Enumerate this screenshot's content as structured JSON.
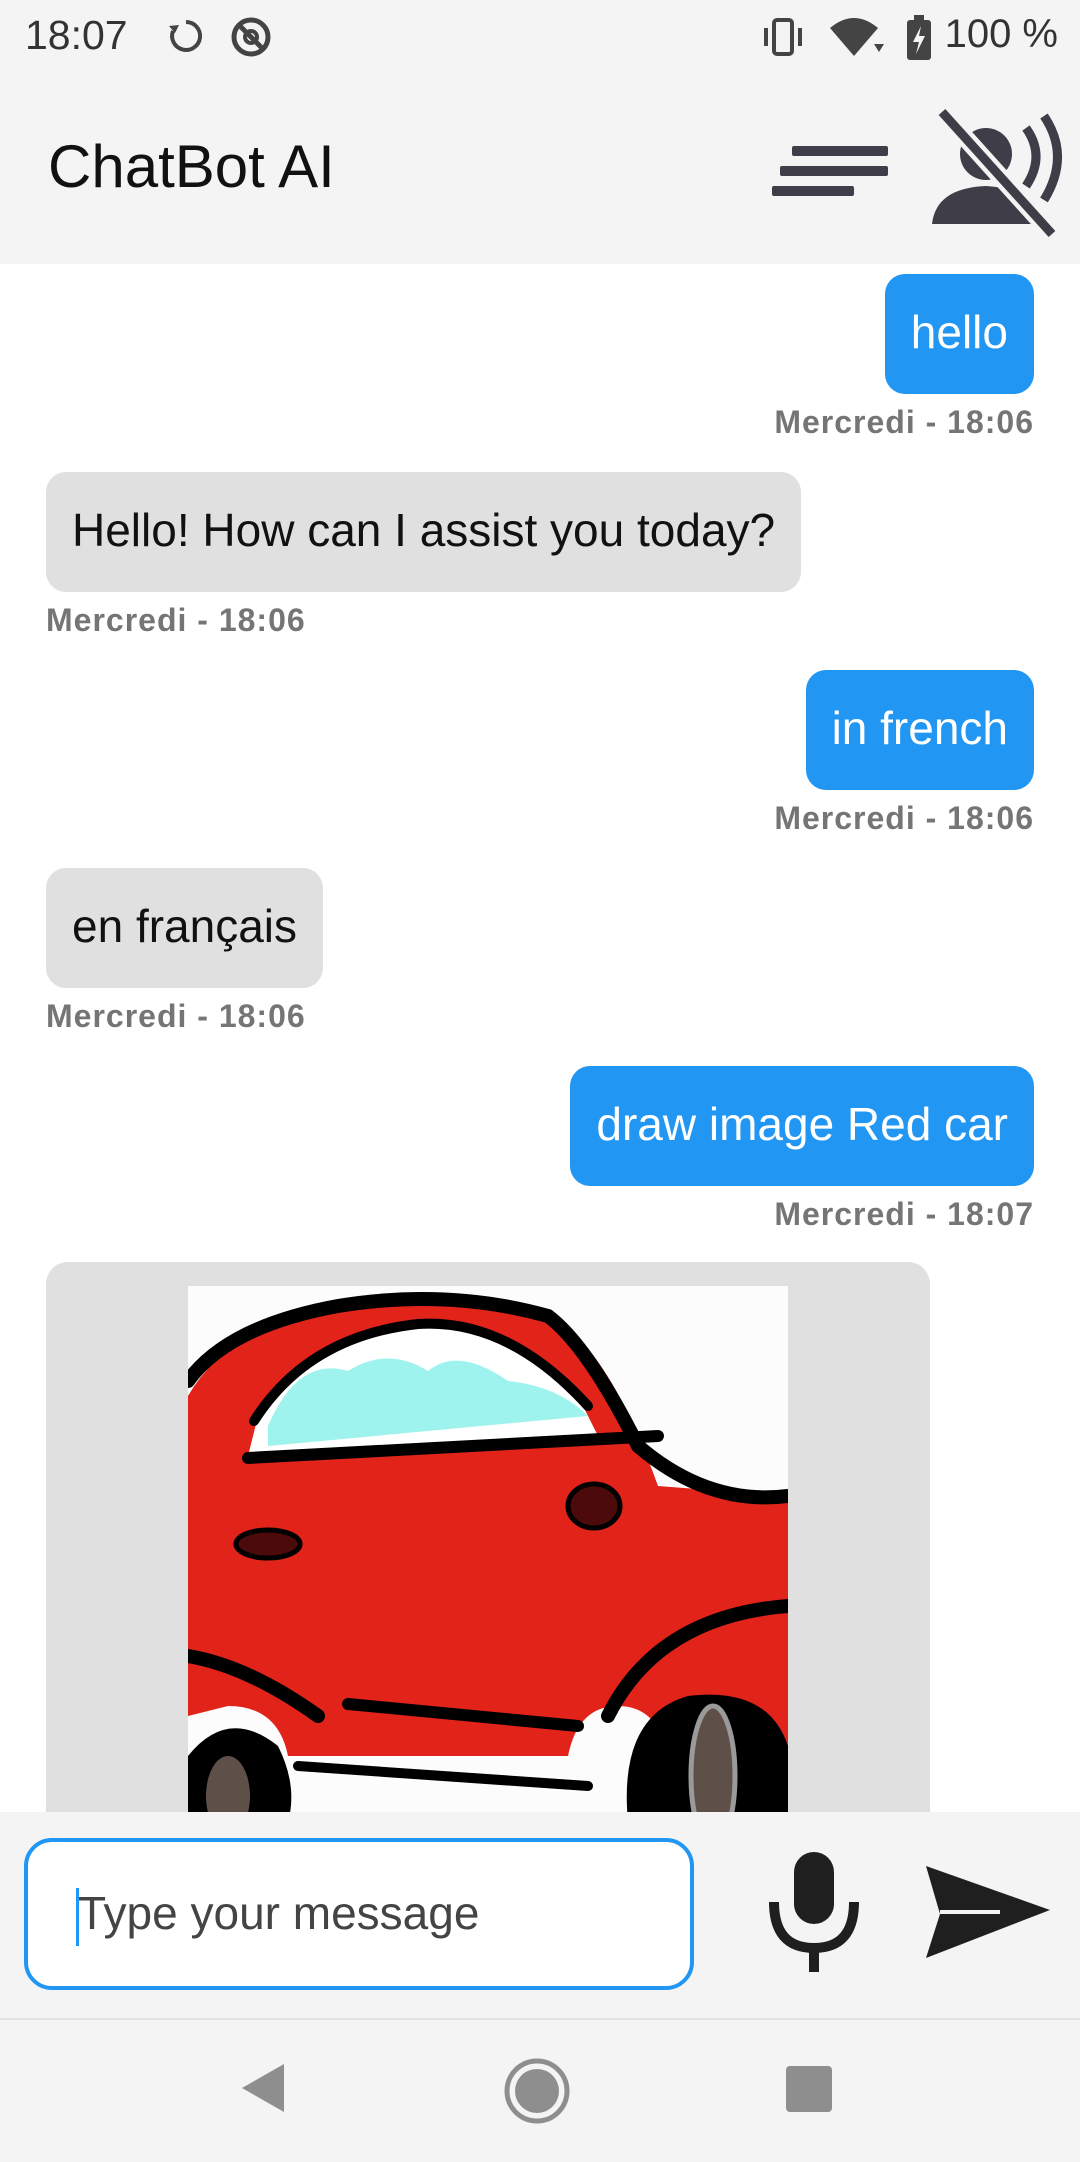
{
  "status_bar": {
    "time": "18:07",
    "battery_text": "100 %",
    "icons": [
      "sync-icon",
      "data-saver-icon",
      "vibrate-icon",
      "wifi-icon",
      "battery-charging-icon"
    ]
  },
  "app_bar": {
    "title": "ChatBot AI",
    "actions": [
      "menu-icon",
      "voice-off-icon"
    ]
  },
  "messages": [
    {
      "role": "user",
      "text": "hello",
      "time": "Mercredi - 18:06"
    },
    {
      "role": "bot",
      "text": "Hello! How can I assist you today?",
      "time": "Mercredi - 18:06"
    },
    {
      "role": "user",
      "text": "in french",
      "time": "Mercredi - 18:06"
    },
    {
      "role": "bot",
      "text": "en français",
      "time": "Mercredi - 18:06"
    },
    {
      "role": "user",
      "text": "draw image Red car",
      "time": "Mercredi - 18:07"
    },
    {
      "role": "bot",
      "image": "red-car-drawing"
    }
  ],
  "input": {
    "placeholder": "Type your message",
    "actions": [
      "mic-icon",
      "send-icon"
    ]
  },
  "colors": {
    "accent": "#2196f3",
    "bot_bubble": "#e0e0e0",
    "bar_bg": "#f4f4f5"
  }
}
